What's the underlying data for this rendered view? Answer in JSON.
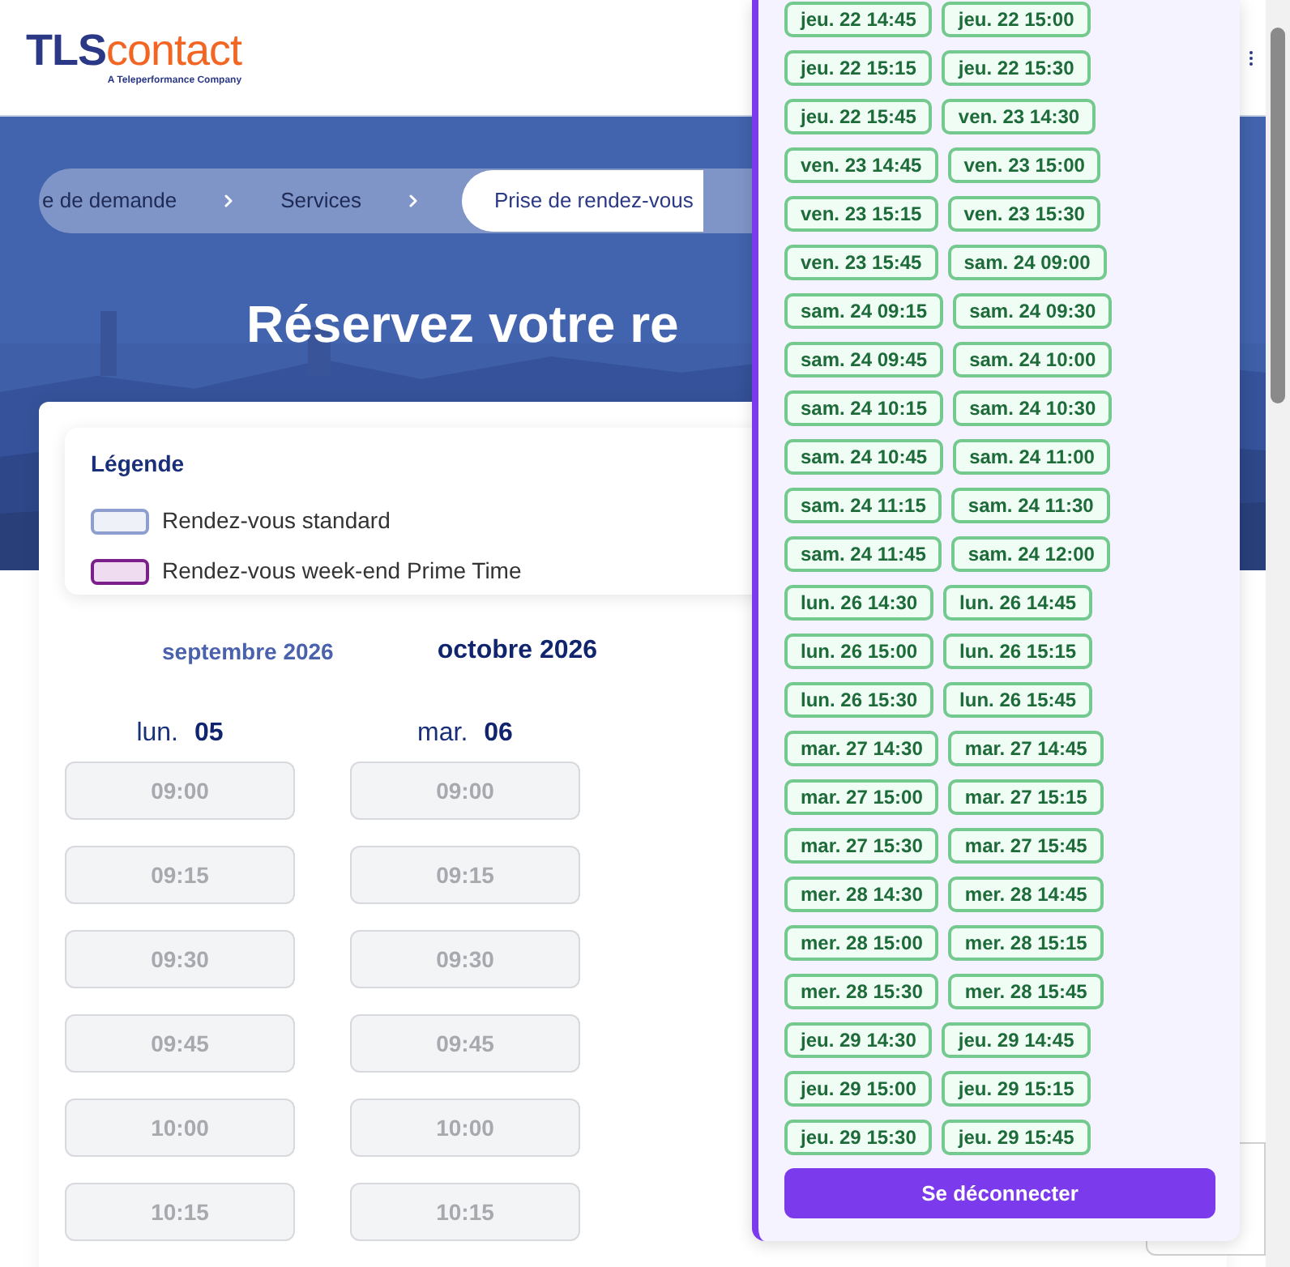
{
  "header": {
    "logo": {
      "primary": "TLS",
      "secondary": "contact",
      "tagline": "A Teleperformance Company"
    }
  },
  "breadcrumb": [
    {
      "label": "e de demande",
      "selected": false
    },
    {
      "label": "Services",
      "selected": false
    },
    {
      "label": "Prise de rendez-vous",
      "selected": true
    }
  ],
  "hero": {
    "title": "Réservez votre re"
  },
  "legend": {
    "title": "Légende",
    "items": [
      {
        "label": "Rendez-vous standard",
        "kind": "standard"
      },
      {
        "label": "Rendez-vous week-end Prime Time",
        "kind": "prime"
      }
    ]
  },
  "months": [
    {
      "label": "septembre 2026",
      "selected": false
    },
    {
      "label": "octobre 2026",
      "selected": true
    }
  ],
  "days": [
    {
      "weekday": "lun.",
      "date": "05",
      "slots": [
        {
          "time": "09:00",
          "disabled": true
        },
        {
          "time": "09:15",
          "disabled": true
        },
        {
          "time": "09:30",
          "disabled": true
        },
        {
          "time": "09:45",
          "disabled": true
        },
        {
          "time": "10:00",
          "disabled": true
        },
        {
          "time": "10:15",
          "disabled": true
        }
      ]
    },
    {
      "weekday": "mar.",
      "date": "06",
      "slots": [
        {
          "time": "09:00",
          "disabled": true
        },
        {
          "time": "09:15",
          "disabled": true
        },
        {
          "time": "09:30",
          "disabled": true
        },
        {
          "time": "09:45",
          "disabled": true
        },
        {
          "time": "10:00",
          "disabled": true
        },
        {
          "time": "10:15",
          "disabled": true
        }
      ]
    }
  ],
  "availability_panel": {
    "slots": [
      "jeu. 22 14:45",
      "jeu. 22 15:00",
      "jeu. 22 15:15",
      "jeu. 22 15:30",
      "jeu. 22 15:45",
      "ven. 23 14:30",
      "ven. 23 14:45",
      "ven. 23 15:00",
      "ven. 23 15:15",
      "ven. 23 15:30",
      "ven. 23 15:45",
      "sam. 24 09:00",
      "sam. 24 09:15",
      "sam. 24 09:30",
      "sam. 24 09:45",
      "sam. 24 10:00",
      "sam. 24 10:15",
      "sam. 24 10:30",
      "sam. 24 10:45",
      "sam. 24 11:00",
      "sam. 24 11:15",
      "sam. 24 11:30",
      "sam. 24 11:45",
      "sam. 24 12:00",
      "lun. 26 14:30",
      "lun. 26 14:45",
      "lun. 26 15:00",
      "lun. 26 15:15",
      "lun. 26 15:30",
      "lun. 26 15:45",
      "mar. 27 14:30",
      "mar. 27 14:45",
      "mar. 27 15:00",
      "mar. 27 15:15",
      "mar. 27 15:30",
      "mar. 27 15:45",
      "mer. 28 14:30",
      "mer. 28 14:45",
      "mer. 28 15:00",
      "mer. 28 15:15",
      "mer. 28 15:30",
      "mer. 28 15:45",
      "jeu. 29 14:30",
      "jeu. 29 14:45",
      "jeu. 29 15:00",
      "jeu. 29 15:15",
      "jeu. 29 15:30",
      "jeu. 29 15:45"
    ],
    "logout_button": "Se déconnecter"
  }
}
